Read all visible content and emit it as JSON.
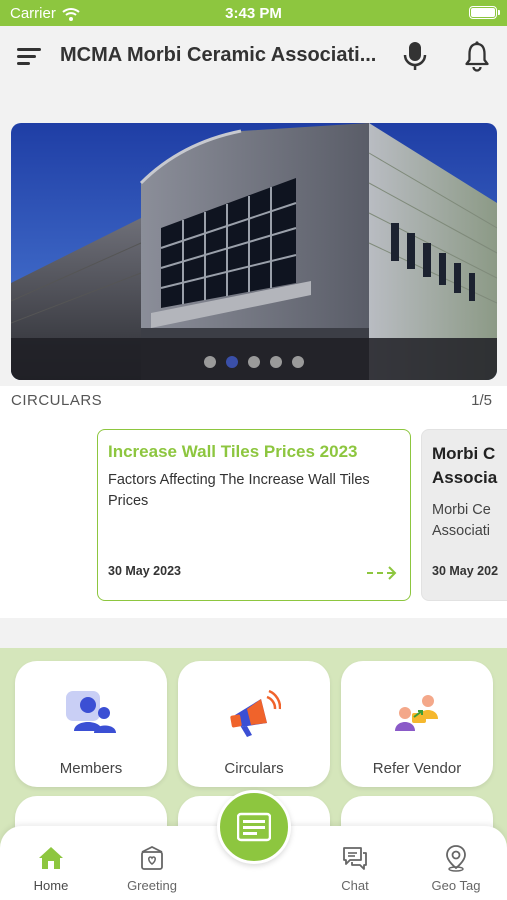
{
  "status_bar": {
    "carrier": "Carrier",
    "time": "3:43 PM"
  },
  "app_bar": {
    "title": "MCMA Morbi Ceramic Associati..."
  },
  "banner": {
    "slide_count": 5,
    "active_slide": 2
  },
  "circulars": {
    "heading": "CIRCULARS",
    "count": "1/5",
    "cards": [
      {
        "title": "Increase Wall Tiles Prices  2023",
        "description": "Factors Affecting The Increase Wall Tiles Prices",
        "date": "30 May 2023"
      },
      {
        "title": "Morbi C Associa",
        "description": "Morbi Ce Associati",
        "date": "30 May 202"
      }
    ]
  },
  "quick_actions": [
    {
      "label": "Members",
      "icon": "members-icon"
    },
    {
      "label": "Circulars",
      "icon": "megaphone-icon"
    },
    {
      "label": "Refer Vendor",
      "icon": "refer-vendor-icon"
    }
  ],
  "bottom_nav": {
    "items": [
      {
        "label": "Home",
        "icon": "home-icon"
      },
      {
        "label": "Greeting",
        "icon": "greeting-icon"
      },
      {
        "label": "Chat",
        "icon": "chat-icon"
      },
      {
        "label": "Geo Tag",
        "icon": "location-pin-icon"
      }
    ],
    "active": "Home",
    "fab_icon": "card-icon"
  },
  "colors": {
    "accent": "#8dc63f",
    "grid_bg": "#d5e6bb",
    "active_dot": "#3a4fa8"
  }
}
